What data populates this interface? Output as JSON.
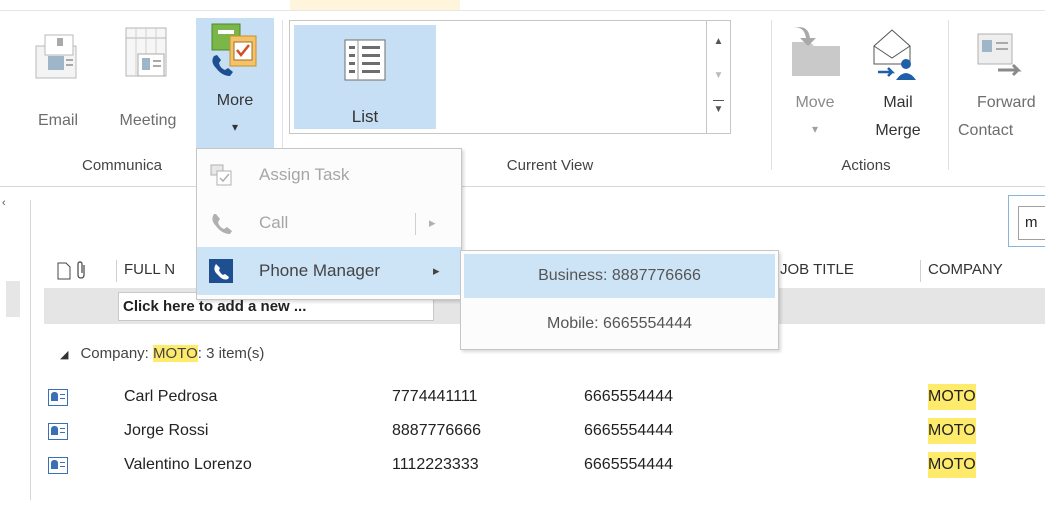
{
  "ribbon": {
    "email_label": "Email",
    "meeting_label": "Meeting",
    "more_label": "More",
    "more_chevron": "▾",
    "communicate_group": "Communica",
    "list_label": "List",
    "current_view_group": "Current View",
    "move_label": "Move",
    "move_chevron": "▾",
    "mail_merge_line1": "Mail",
    "mail_merge_line2": "Merge",
    "forward_line1": "Forward",
    "forward_line2": "Contact",
    "actions_group": "Actions"
  },
  "menu": {
    "assign_task": "Assign Task",
    "call": "Call",
    "phone_manager": "Phone Manager",
    "submenu_arrow": "▸"
  },
  "submenu": {
    "business": "Business: 8887776666",
    "mobile": "Mobile: 6665554444"
  },
  "table": {
    "headers": {
      "full_name": "FULL N",
      "job_title": "JOB TITLE",
      "company": "COMPANY"
    },
    "new_row_placeholder": "Click here to add a new ...",
    "group": {
      "prefix": "Company: ",
      "name": "MOTO",
      "suffix": ": 3 item(s)"
    },
    "rows": [
      {
        "name": "Carl Pedrosa",
        "phone1": "7774441111",
        "phone2": "6665554444",
        "company": "MOTO"
      },
      {
        "name": "Jorge Rossi",
        "phone1": "8887776666",
        "phone2": "6665554444",
        "company": "MOTO"
      },
      {
        "name": "Valentino Lorenzo",
        "phone1": "1112223333",
        "phone2": "6665554444",
        "company": "MOTO"
      }
    ]
  },
  "search": {
    "value": "m"
  },
  "colors": {
    "accent": "#1e5fa8",
    "highlight": "#ffeb6b",
    "selection": "#cde4f7"
  }
}
